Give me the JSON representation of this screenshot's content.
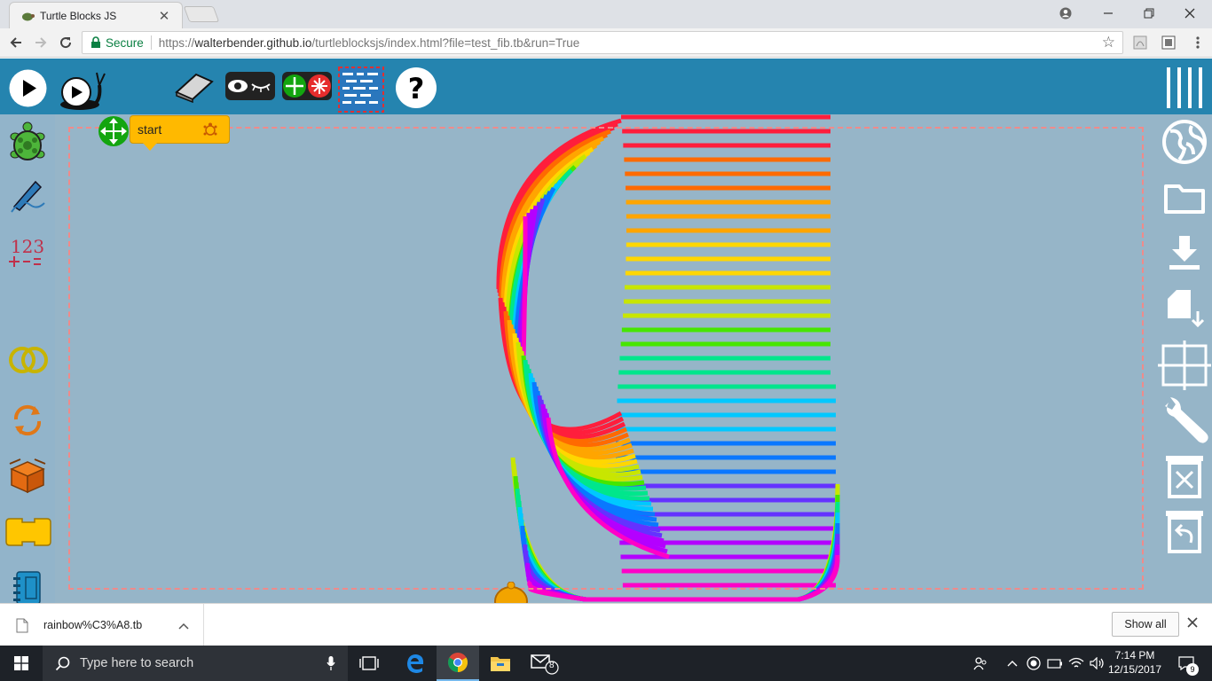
{
  "browser": {
    "tab_title": "Turtle Blocks JS",
    "tab_close": "✕",
    "omnibox": {
      "secure_label": "Secure",
      "url_scheme": "https://",
      "url_host": "walterbender.github.io",
      "url_path": "/turtleblocksjs/index.html?file=test_fib.tb&run=True"
    }
  },
  "app": {
    "start_block_label": "start",
    "toolbar_icons": [
      "play-icon",
      "slow-play-snail-icon",
      "eraser-icon",
      "hide-show-blocks-icon",
      "collapse-expand-icon",
      "grid-toggle-icon",
      "help-icon"
    ],
    "palette_icons": [
      "turtle-palette-icon",
      "pen-palette-icon",
      "number-palette-icon",
      "boolean-palette-icon",
      "flow-palette-icon",
      "action-box-palette-icon",
      "block-palette-icon",
      "media-palette-icon",
      "sensors-palette-icon"
    ],
    "right_icons": [
      "menu-icon",
      "planet-icon",
      "open-file-icon",
      "save-icon",
      "load-plugin-icon",
      "grid-icon",
      "settings-icon",
      "trash-icon",
      "restore-trash-icon"
    ],
    "rainbow_colors": [
      "#ff1e3c",
      "#ff6a00",
      "#ffa500",
      "#ffd700",
      "#c8e600",
      "#46e600",
      "#00e68c",
      "#00c8ff",
      "#0a78ff",
      "#6432ff",
      "#b400ff",
      "#ff00c8"
    ]
  },
  "download_bar": {
    "filename": "rainbow%C3%A8.tb",
    "show_all_label": "Show all"
  },
  "taskbar": {
    "search_placeholder": "Type here to search",
    "mail_badge": "8",
    "time": "7:14 PM",
    "date": "12/15/2017",
    "notification_count": "9"
  }
}
